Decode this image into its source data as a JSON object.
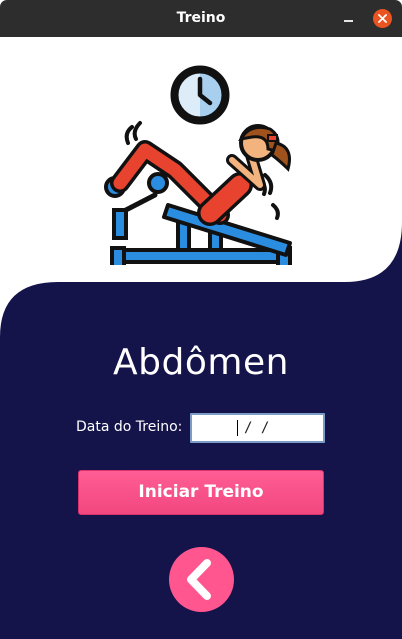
{
  "window": {
    "title": "Treino"
  },
  "main": {
    "heading": "Abdômen",
    "date_label": "Data do Treino:",
    "date_value_mask": "/ /",
    "start_button_label": "Iniciar Treino"
  },
  "icons": {
    "hero": "woman-doing-sit-ups-on-bench-with-clock-illustration",
    "back": "chevron-left-icon",
    "close": "close-icon",
    "minimize": "minimize-icon"
  },
  "colors": {
    "navy": "#14134a",
    "accent_pink": "#ff5690",
    "titlebar": "#2d2d2d",
    "close_orange": "#e95420"
  }
}
